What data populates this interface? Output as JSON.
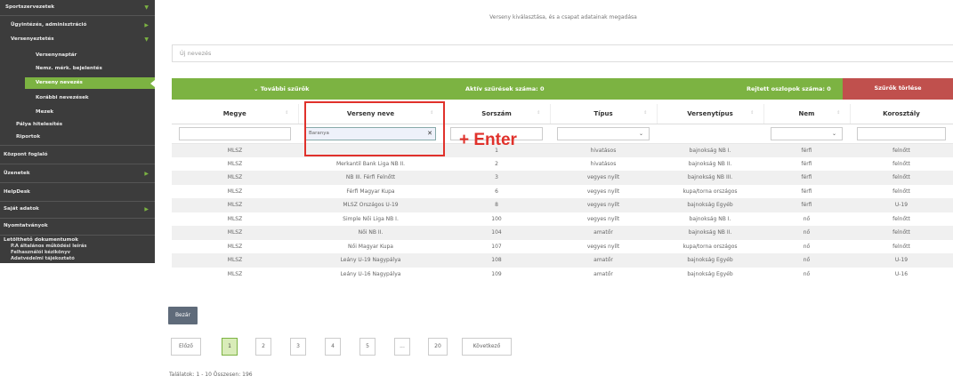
{
  "sidebar": {
    "items": [
      {
        "label": "Sportszervezetek",
        "chevron": "▼"
      },
      {
        "label": "Ügyintézés, adminisztráció",
        "chevron": "▶"
      },
      {
        "label": "Versenyeztetés",
        "chevron": "▼"
      },
      {
        "label": "Versenynaptár",
        "chevron": ""
      },
      {
        "label": "Nemz. mérk. bejelentés",
        "chevron": ""
      },
      {
        "label": "Verseny nevezés",
        "chevron": ""
      },
      {
        "label": "Korábbi nevezések",
        "chevron": ""
      },
      {
        "label": "Mezek",
        "chevron": ""
      },
      {
        "label": "Pálya hitelesítés",
        "chevron": ""
      },
      {
        "label": "Riportok",
        "chevron": ""
      },
      {
        "label": "Központ foglaló",
        "chevron": ""
      },
      {
        "label": "Üzenetek",
        "chevron": "▶"
      },
      {
        "label": "HelpDesk",
        "chevron": ""
      },
      {
        "label": "Saját adatok",
        "chevron": "▶"
      },
      {
        "label": "Nyomtatványok",
        "chevron": ""
      },
      {
        "label": "Letölthető dokumentumok",
        "chevron": ""
      }
    ],
    "docs": [
      "P.A általános működési leírás",
      "Felhasználói kézikönyv",
      "Adatvédelmi tájékoztató"
    ]
  },
  "main": {
    "page_title": "Verseny kiválasztása, és a csapat adatainak megadása",
    "new_entry_label": "Új nevezés",
    "filter_bar": {
      "more_filters": "⌄ További szűrők",
      "active_filters": "Aktív szűrések száma: 0",
      "hidden_columns": "Rejtett oszlopok száma: 0",
      "clear_filters": "Szűrők törlése"
    },
    "table": {
      "headers": [
        "Megye",
        "Verseny neve",
        "Sorszám",
        "Típus",
        "Versenytípus",
        "Nem",
        "Korosztály"
      ],
      "sort_glyph": "⇕",
      "filter_name_value": "Baranya",
      "clear_glyph": "✕",
      "dropdown_glyph": "⌄",
      "rows": [
        [
          "MLSZ",
          "",
          "1",
          "hivatásos",
          "bajnokság NB I.",
          "férfi",
          "felnőtt"
        ],
        [
          "MLSZ",
          "Merkantil Bank Liga NB II.",
          "2",
          "hivatásos",
          "bajnokság NB II.",
          "férfi",
          "felnőtt"
        ],
        [
          "MLSZ",
          "NB III. Férfi Felnőtt",
          "3",
          "vegyes nyílt",
          "bajnokság NB III.",
          "férfi",
          "felnőtt"
        ],
        [
          "MLSZ",
          "Férfi Magyar Kupa",
          "6",
          "vegyes nyílt",
          "kupa/torna országos",
          "férfi",
          "felnőtt"
        ],
        [
          "MLSZ",
          "MLSZ Országos U-19",
          "8",
          "vegyes nyílt",
          "bajnokság Egyéb",
          "férfi",
          "U-19"
        ],
        [
          "MLSZ",
          "Simple Női Liga NB I.",
          "100",
          "vegyes nyílt",
          "bajnokság NB I.",
          "nő",
          "felnőtt"
        ],
        [
          "MLSZ",
          "Női NB II.",
          "104",
          "amatőr",
          "bajnokság NB II.",
          "nő",
          "felnőtt"
        ],
        [
          "MLSZ",
          "Női Magyar Kupa",
          "107",
          "vegyes nyílt",
          "kupa/torna országos",
          "nő",
          "felnőtt"
        ],
        [
          "MLSZ",
          "Leány U-19 Nagypálya",
          "108",
          "amatőr",
          "bajnokság Egyéb",
          "nő",
          "U-19"
        ],
        [
          "MLSZ",
          "Leány U-16 Nagypálya",
          "109",
          "amatőr",
          "bajnokság Egyéb",
          "nő",
          "U-16"
        ]
      ]
    },
    "annotation": "+ Enter",
    "close_button": "Bezár",
    "pagination": {
      "prev": "Előző",
      "pages": [
        "1",
        "2",
        "3",
        "4",
        "5",
        "...",
        "20"
      ],
      "next": "Következő"
    },
    "results_text": "Találatok: 1 - 10 Összesen: 196"
  },
  "colors": {
    "accent": "#7cb342",
    "danger": "#c0504d",
    "annotation": "#e0312b",
    "sidebar": "#3c3c3c"
  }
}
